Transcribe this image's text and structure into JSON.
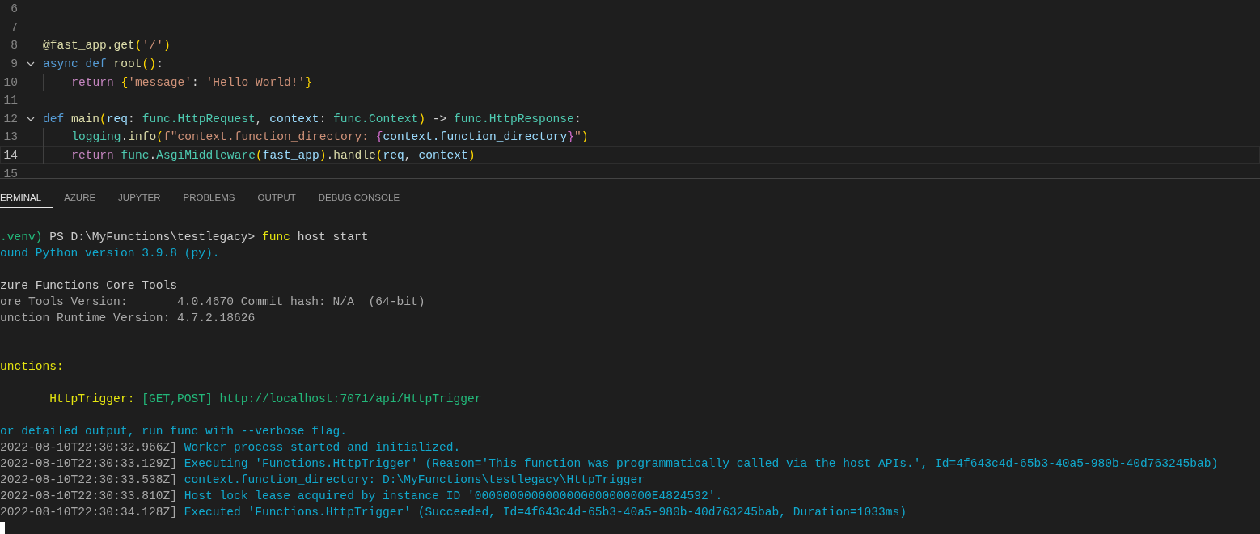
{
  "editor": {
    "lines": [
      {
        "number": "6"
      },
      {
        "number": "7"
      },
      {
        "number": "8",
        "tokens": [
          {
            "text": "@fast_app.get",
            "kind": "func"
          },
          {
            "text": "(",
            "kind": "bracket1"
          },
          {
            "text": "'/'",
            "kind": "string"
          },
          {
            "text": ")",
            "kind": "bracket1"
          }
        ]
      },
      {
        "number": "9",
        "foldable": true,
        "tokens": [
          {
            "text": "async ",
            "kind": "keyword"
          },
          {
            "text": "def ",
            "kind": "keyword"
          },
          {
            "text": "root",
            "kind": "func"
          },
          {
            "text": "()",
            "kind": "bracket1"
          },
          {
            "text": ":"
          }
        ]
      },
      {
        "number": "10",
        "indented": true,
        "tokens": [
          {
            "text": "return ",
            "kind": "control"
          },
          {
            "text": "{",
            "kind": "bracket1"
          },
          {
            "text": "'message'",
            "kind": "string"
          },
          {
            "text": ": "
          },
          {
            "text": "'Hello World!'",
            "kind": "string"
          },
          {
            "text": "}",
            "kind": "bracket1"
          }
        ]
      },
      {
        "number": "11"
      },
      {
        "number": "12",
        "foldable": true,
        "tokens": [
          {
            "text": "def ",
            "kind": "keyword"
          },
          {
            "text": "main",
            "kind": "func"
          },
          {
            "text": "(",
            "kind": "bracket1"
          },
          {
            "text": "req",
            "kind": "param"
          },
          {
            "text": ": "
          },
          {
            "text": "func.HttpRequest",
            "kind": "type"
          },
          {
            "text": ", "
          },
          {
            "text": "context",
            "kind": "param"
          },
          {
            "text": ": "
          },
          {
            "text": "func.Context",
            "kind": "type"
          },
          {
            "text": ")",
            "kind": "bracket1"
          },
          {
            "text": " -> "
          },
          {
            "text": "func.HttpResponse",
            "kind": "type"
          },
          {
            "text": ":"
          }
        ]
      },
      {
        "number": "13",
        "indented": true,
        "tokens": [
          {
            "text": "logging",
            "kind": "type"
          },
          {
            "text": "."
          },
          {
            "text": "info",
            "kind": "func"
          },
          {
            "text": "(",
            "kind": "bracket1"
          },
          {
            "text": "f\"context.function_directory: ",
            "kind": "string"
          },
          {
            "text": "{",
            "kind": "bracket2"
          },
          {
            "text": "context.function_directory",
            "kind": "param"
          },
          {
            "text": "}",
            "kind": "bracket2"
          },
          {
            "text": "\"",
            "kind": "string"
          },
          {
            "text": ")",
            "kind": "bracket1"
          }
        ]
      },
      {
        "number": "14",
        "current": true,
        "indented": true,
        "tokens": [
          {
            "text": "return ",
            "kind": "control"
          },
          {
            "text": "func",
            "kind": "type"
          },
          {
            "text": "."
          },
          {
            "text": "AsgiMiddleware",
            "kind": "type"
          },
          {
            "text": "(",
            "kind": "bracket1"
          },
          {
            "text": "fast_app",
            "kind": "param"
          },
          {
            "text": ")",
            "kind": "bracket1"
          },
          {
            "text": "."
          },
          {
            "text": "handle",
            "kind": "func"
          },
          {
            "text": "(",
            "kind": "bracket1"
          },
          {
            "text": "req",
            "kind": "param"
          },
          {
            "text": ", "
          },
          {
            "text": "context",
            "kind": "param"
          },
          {
            "text": ")",
            "kind": "bracket1"
          }
        ]
      },
      {
        "number": "15"
      }
    ]
  },
  "panel": {
    "tabs": [
      {
        "label": "ERMINAL",
        "selected": true
      },
      {
        "label": "AZURE",
        "selected": false
      },
      {
        "label": "JUPYTER",
        "selected": false
      },
      {
        "label": "PROBLEMS",
        "selected": false
      },
      {
        "label": "OUTPUT",
        "selected": false
      },
      {
        "label": "DEBUG CONSOLE",
        "selected": false
      }
    ],
    "terminal": {
      "lines": [
        {
          "kind": "text",
          "tokens": [
            {
              "text": ".venv)",
              "kind": "green"
            },
            {
              "text": " PS D:\\MyFunctions\\testlegacy> ",
              "kind": "plain"
            },
            {
              "text": "func",
              "kind": "yellow"
            },
            {
              "text": " host start",
              "kind": "plain"
            }
          ]
        },
        {
          "kind": "text",
          "tokens": [
            {
              "text": "ound Python version 3.9.8 (py).",
              "kind": "cyan"
            }
          ]
        },
        {
          "kind": "blank"
        },
        {
          "kind": "text",
          "tokens": [
            {
              "text": "zure Functions Core Tools",
              "kind": "plain"
            }
          ]
        },
        {
          "kind": "text",
          "tokens": [
            {
              "text": "ore Tools Version:       4.0.4670 Commit hash: N/A  (64-bit)",
              "kind": "dim"
            }
          ]
        },
        {
          "kind": "text",
          "tokens": [
            {
              "text": "unction Runtime Version: 4.7.2.18626",
              "kind": "dim"
            }
          ]
        },
        {
          "kind": "blank"
        },
        {
          "kind": "blank"
        },
        {
          "kind": "text",
          "tokens": [
            {
              "text": "unctions:",
              "kind": "yellow"
            }
          ]
        },
        {
          "kind": "blank"
        },
        {
          "kind": "text",
          "tokens": [
            {
              "text": "       HttpTrigger:",
              "kind": "yellow"
            },
            {
              "text": " [GET,POST] http://localhost:7071/api/HttpTrigger",
              "kind": "green"
            }
          ]
        },
        {
          "kind": "blank"
        },
        {
          "kind": "text",
          "tokens": [
            {
              "text": "or detailed output, run func with --verbose flag.",
              "kind": "cyan"
            }
          ]
        },
        {
          "kind": "text",
          "tokens": [
            {
              "text": "2022-08-10T22:30:32.966Z] ",
              "kind": "dim"
            },
            {
              "text": "Worker process started and initialized.",
              "kind": "cyan"
            }
          ]
        },
        {
          "kind": "text",
          "tokens": [
            {
              "text": "2022-08-10T22:30:33.129Z] ",
              "kind": "dim"
            },
            {
              "text": "Executing 'Functions.HttpTrigger' (Reason='This function was programmatically called via the host APIs.', Id=4f643c4d-65b3-40a5-980b-40d763245bab)",
              "kind": "cyan"
            }
          ]
        },
        {
          "kind": "text",
          "tokens": [
            {
              "text": "2022-08-10T22:30:33.538Z] ",
              "kind": "dim"
            },
            {
              "text": "context.function_directory: D:\\MyFunctions\\testlegacy\\HttpTrigger",
              "kind": "cyan"
            }
          ]
        },
        {
          "kind": "text",
          "tokens": [
            {
              "text": "2022-08-10T22:30:33.810Z] ",
              "kind": "dim"
            },
            {
              "text": "Host lock lease acquired by instance ID '0000000000000000000000000E4824592'.",
              "kind": "cyan"
            }
          ]
        },
        {
          "kind": "text",
          "tokens": [
            {
              "text": "2022-08-10T22:30:34.128Z] ",
              "kind": "dim"
            },
            {
              "text": "Executed 'Functions.HttpTrigger' (Succeeded, Id=4f643c4d-65b3-40a5-980b-40d763245bab, Duration=1033ms)",
              "kind": "cyan"
            }
          ]
        },
        {
          "kind": "cursor"
        }
      ]
    }
  }
}
